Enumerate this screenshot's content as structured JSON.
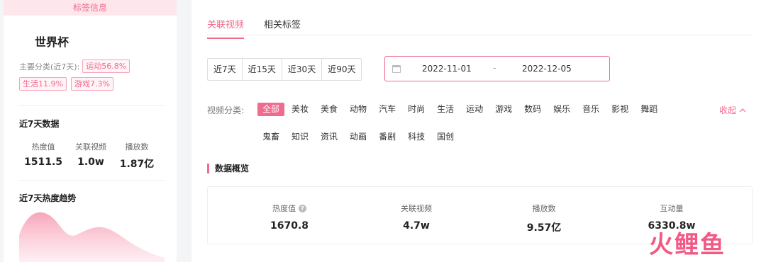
{
  "left": {
    "header": "标签信息",
    "tag_title": "世界杯",
    "category_label": "主要分类(近7天):",
    "categories": [
      "运动56.8%",
      "生活11.9%",
      "游戏7.3%"
    ],
    "stats_title": "近7天数据",
    "stats": [
      {
        "label": "热度值",
        "value": "1511.5"
      },
      {
        "label": "关联视频",
        "value": "1.0w"
      },
      {
        "label": "播放数",
        "value": "1.87亿"
      }
    ],
    "trend_title": "近7天热度趋势",
    "trend_fill_color": "#f9a8bc"
  },
  "tabs": [
    "关联视频",
    "相关标签"
  ],
  "range_buttons": [
    "近7天",
    "近15天",
    "近30天",
    "近90天"
  ],
  "date_range": {
    "start": "2022-11-01",
    "separator": "-",
    "end": "2022-12-05"
  },
  "video_category": {
    "label": "视频分类:",
    "items": [
      "全部",
      "美妆",
      "美食",
      "动物",
      "汽车",
      "时尚",
      "生活",
      "运动",
      "游戏",
      "数码",
      "娱乐",
      "音乐",
      "影视",
      "舞蹈",
      "鬼畜",
      "知识",
      "资讯",
      "动画",
      "番剧",
      "科技",
      "国创"
    ],
    "active": "全部",
    "collapse_label": "收起"
  },
  "overview": {
    "title": "数据概览",
    "items": [
      {
        "label": "热度值",
        "value": "1670.8",
        "help": true
      },
      {
        "label": "关联视频",
        "value": "4.7w"
      },
      {
        "label": "播放数",
        "value": "9.57亿"
      },
      {
        "label": "互动量",
        "value": "6330.8w"
      }
    ]
  },
  "watermark": "火鲤鱼",
  "accent_color": "#f06b8e"
}
